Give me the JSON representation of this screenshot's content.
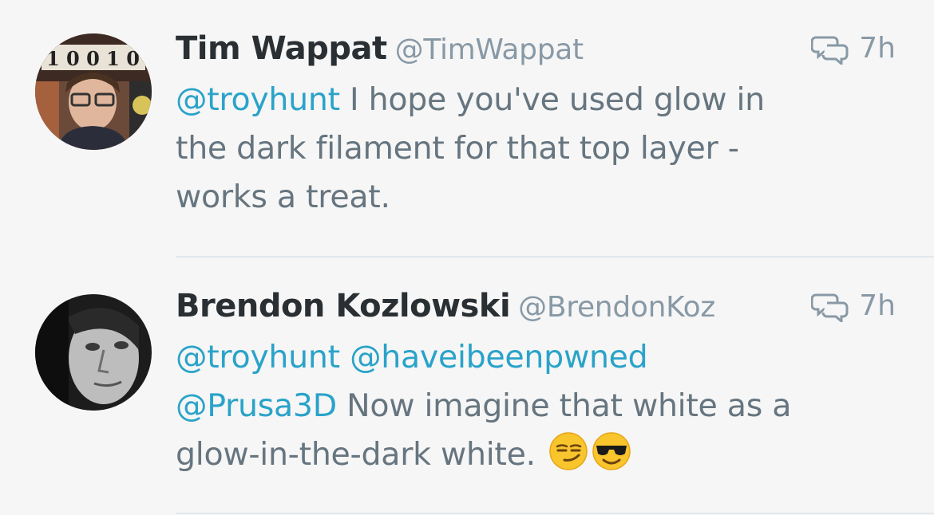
{
  "tweets": [
    {
      "display_name": "Tim Wappat",
      "handle": "@TimWappat",
      "time": "7h",
      "avatar_icon": "profile-photo-man-glasses",
      "text_lines": [
        {
          "mention": "@troyhunt",
          "text": " I hope you've used glow in"
        },
        {
          "text": "the dark filament for that top layer -"
        },
        {
          "text": "works a treat."
        }
      ]
    },
    {
      "display_name": "Brendon Kozlowski",
      "handle": "@BrendonKoz",
      "time": "7h",
      "avatar_icon": "profile-photo-man-monochrome",
      "text_lines": [
        {
          "mention": "@troyhunt",
          "text": " ",
          "mention2": "@haveibeenpwned"
        },
        {
          "mention": "@Prusa3D",
          "text": " Now imagine that white as a"
        },
        {
          "text": "glow-in-the-dark white. "
        }
      ],
      "emojis": [
        "smirking-face-emoji",
        "sunglasses-face-emoji"
      ]
    }
  ],
  "icons": {
    "conversation": "conversation-icon"
  },
  "colors": {
    "name": "#292f33",
    "secondary": "#8899a6",
    "body": "#66757f",
    "mention": "#2aa3c9",
    "divider": "#e1e8ed",
    "background": "#f6f6f6"
  }
}
